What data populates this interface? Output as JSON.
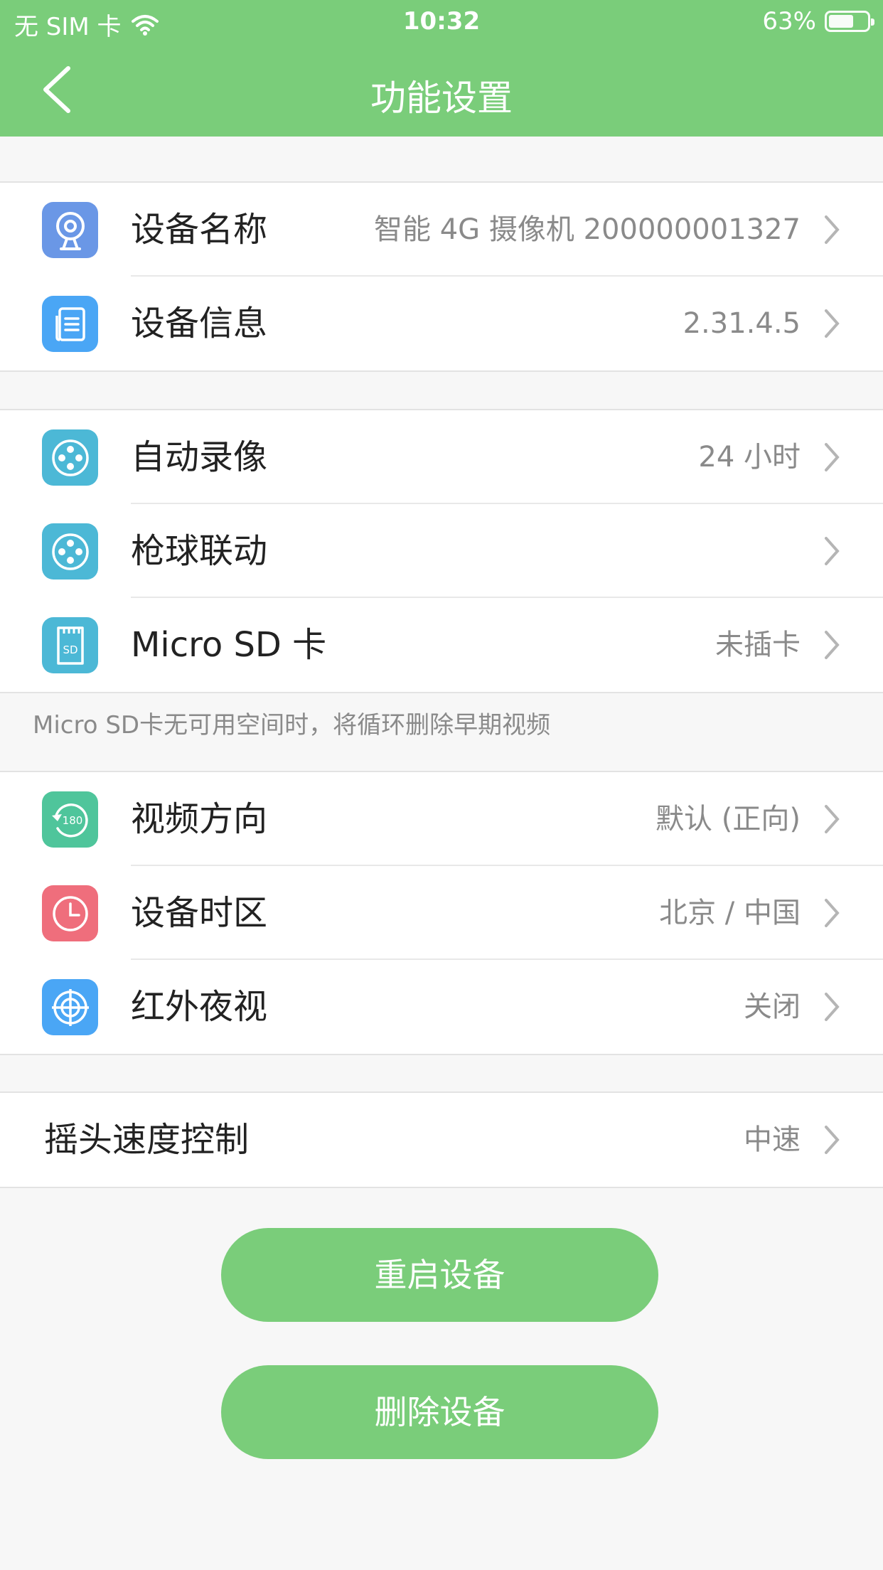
{
  "status": {
    "carrier": "无 SIM 卡",
    "time": "10:32",
    "battery": "63%"
  },
  "nav": {
    "title": "功能设置"
  },
  "group1": [
    {
      "label": "设备名称",
      "value": "智能 4G 摄像机 200000001327",
      "icon": "webcam-icon",
      "color": "#6a97e6"
    },
    {
      "label": "设备信息",
      "value": "2.31.4.5",
      "icon": "document-icon",
      "color": "#4aa6f5"
    }
  ],
  "group2": [
    {
      "label": "自动录像",
      "value": "24 小时",
      "icon": "film-reel-icon",
      "color": "#4cb8d6"
    },
    {
      "label": "枪球联动",
      "value": "",
      "icon": "film-reel-icon",
      "color": "#4cb8d6"
    },
    {
      "label": "Micro SD 卡",
      "value": "未插卡",
      "icon": "sd-card-icon",
      "color": "#4cb8d6"
    }
  ],
  "note": "Micro SD卡无可用空间时，将循环删除早期视频",
  "group3": [
    {
      "label": "视频方向",
      "value": "默认 (正向)",
      "icon": "rotate-180-icon",
      "color": "#4fc59b"
    },
    {
      "label": "设备时区",
      "value": "北京 / 中国",
      "icon": "clock-icon",
      "color": "#ef6e7c"
    },
    {
      "label": "红外夜视",
      "value": "关闭",
      "icon": "crosshair-icon",
      "color": "#4aa6f5"
    }
  ],
  "group4": [
    {
      "label": "摇头速度控制",
      "value": "中速"
    }
  ],
  "buttons": {
    "restart": "重启设备",
    "delete": "删除设备"
  },
  "theme": {
    "accent": "#7acd7a"
  }
}
